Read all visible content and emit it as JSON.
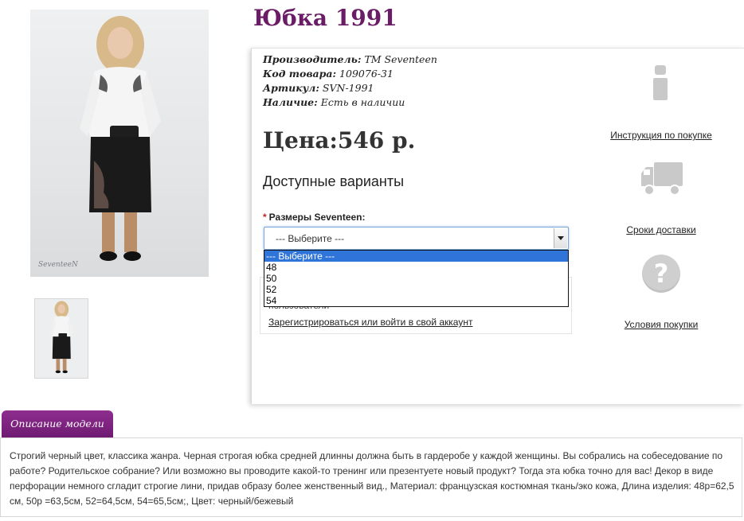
{
  "product": {
    "title": "Юбка 1991",
    "photo_signature": "SeventeeN",
    "meta": [
      {
        "key": "Производитель:",
        "value": " ТМ Seventeen"
      },
      {
        "key": "Код товара:",
        "value": " 109076-31"
      },
      {
        "key": "Артикул:",
        "value": " SVN-1991"
      },
      {
        "key": "Наличие:",
        "value": " Есть в наличии"
      }
    ],
    "price": "Цена:546 р.",
    "variants_heading": "Доступные варианты"
  },
  "size_select": {
    "required_mark": "*",
    "label": "Размеры Seventeen:",
    "current_value": "--- Выберите ---",
    "options": [
      {
        "label": "--- Выберите ---",
        "selected": true
      },
      {
        "label": "48",
        "selected": false
      },
      {
        "label": "50",
        "selected": false
      },
      {
        "label": "52",
        "selected": false
      },
      {
        "label": "54",
        "selected": false
      }
    ]
  },
  "login": {
    "hint": "пользователи",
    "link": "Зарегистрироваться или войти в свой аккаунт"
  },
  "sidebar": {
    "instructions": {
      "label": "Инструкция по покупке",
      "icon": "info-icon"
    },
    "delivery": {
      "label": "Сроки доставки",
      "icon": "truck-icon"
    },
    "terms": {
      "label": "Условия покупки",
      "icon": "question-icon"
    }
  },
  "description": {
    "tab_label": "Описание модели",
    "text": "Строгий черный цвет, классика жанра. Черная строгая юбка средней длинны должна быть в гардеробе у каждой женщины. Вы собрались на собеседование по работе? Родительское собрание? Или возможно вы проводите какой-то тренинг или презентуете новый продукт? Тогда эта юбка точно для вас! Декор в виде перфорации немного сгладит строгие лини, придав образу более женственный вид., Материал: французская костюмная ткань/эко кожа, Длина изделия: 48р=62,5 см, 50р =63,5см, 52=64,5см, 54=65,5см;, Цвет: черный/бежевый"
  },
  "colors": {
    "brand_purple": "#6a1d66",
    "tab_purple": "#7d2380",
    "selected_option": "#2f74d8",
    "icon_grey": "#c9c9c9"
  }
}
